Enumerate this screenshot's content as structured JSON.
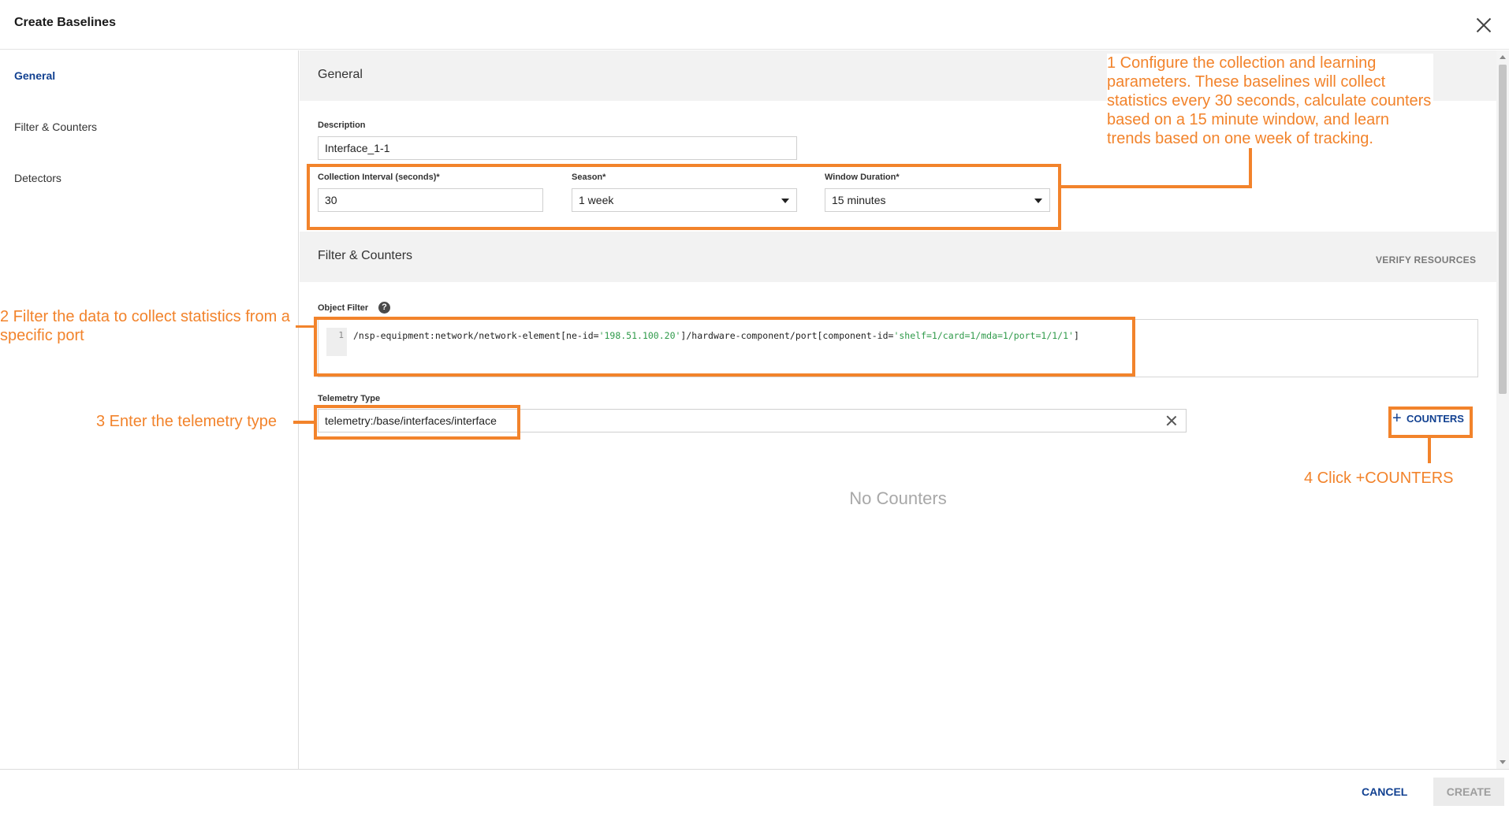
{
  "dialog": {
    "title": "Create Baselines"
  },
  "sidebar": {
    "items": [
      {
        "label": "General",
        "active": true
      },
      {
        "label": "Filter & Counters",
        "active": false
      },
      {
        "label": "Detectors",
        "active": false
      }
    ]
  },
  "general": {
    "section_title": "General",
    "description": {
      "label": "Description",
      "value": "Interface_1-1"
    },
    "collection_interval": {
      "label": "Collection Interval (seconds)*",
      "value": "30"
    },
    "season": {
      "label": "Season*",
      "value": "1 week"
    },
    "window_duration": {
      "label": "Window Duration*",
      "value": "15 minutes"
    }
  },
  "filter_counters": {
    "section_title": "Filter & Counters",
    "verify_resources": "VERIFY RESOURCES",
    "object_filter": {
      "label": "Object Filter",
      "help_icon": "?",
      "line_number": "1",
      "code_part1": "/nsp-equipment:network/network-element[ne-id=",
      "code_str1": "'198.51.100.20'",
      "code_part2": "]/hardware-component/port[component-id=",
      "code_str2": "'shelf=1/card=1/mda=1/port=1/1/1'",
      "code_part3": "]"
    },
    "telemetry_type": {
      "label": "Telemetry Type",
      "value": "telemetry:/base/interfaces/interface"
    },
    "counters_button": {
      "icon": "+",
      "label": "COUNTERS"
    },
    "empty_state": "No Counters"
  },
  "footer": {
    "cancel_label": "CANCEL",
    "create_label": "CREATE"
  },
  "annotations": {
    "step1": "1 Configure the collection and learning parameters. These baselines will collect statistics every 30 seconds, calculate counters based on a 15 minute window, and learn trends based on one week of tracking.",
    "step2": "2 Filter the data to collect statistics from a specific port",
    "step3": "3 Enter the telemetry type",
    "step4": "4 Click +COUNTERS"
  },
  "colors": {
    "annotation": "#f2832b",
    "primary": "#124191",
    "code_string": "#2f9a4a"
  }
}
